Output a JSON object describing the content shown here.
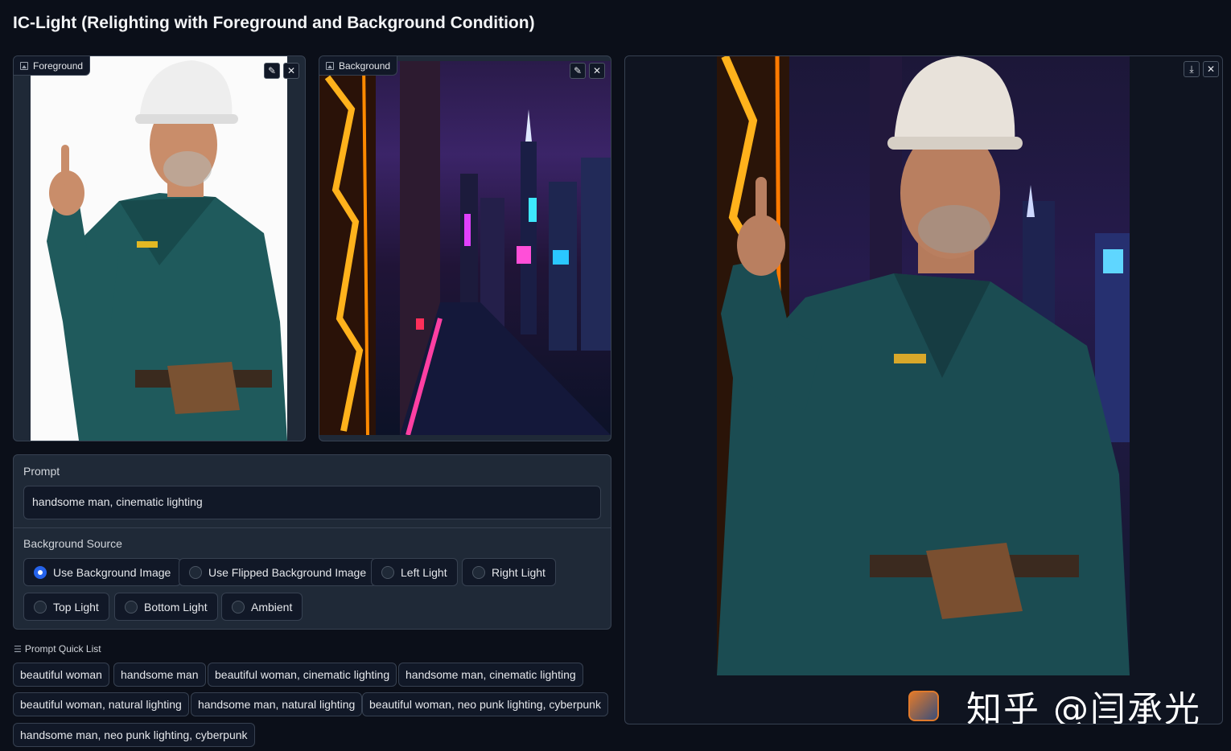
{
  "title": "IC-Light (Relighting with Foreground and Background Condition)",
  "foreground": {
    "label": "Foreground"
  },
  "background": {
    "label": "Background"
  },
  "prompt": {
    "label": "Prompt",
    "value": "handsome man, cinematic lighting"
  },
  "bg_source": {
    "label": "Background Source",
    "options": [
      {
        "label": "Use Background Image",
        "selected": true
      },
      {
        "label": "Use Flipped Background Image",
        "selected": false
      },
      {
        "label": "Left Light",
        "selected": false
      },
      {
        "label": "Right Light",
        "selected": false
      },
      {
        "label": "Top Light",
        "selected": false
      },
      {
        "label": "Bottom Light",
        "selected": false
      },
      {
        "label": "Ambient",
        "selected": false
      }
    ]
  },
  "quick_list": {
    "label": "Prompt Quick List",
    "items": [
      "beautiful woman",
      "handsome man",
      "beautiful woman, cinematic lighting",
      "handsome man, cinematic lighting",
      "beautiful woman, natural lighting",
      "handsome man, natural lighting",
      "beautiful woman, neo punk lighting, cyberpunk",
      "handsome man, neo punk lighting, cyberpunk"
    ]
  },
  "watermark": "知乎 @闫承光",
  "colors": {
    "accent": "#2563eb",
    "bg": "#0b0f19",
    "panel": "#1f2937"
  }
}
